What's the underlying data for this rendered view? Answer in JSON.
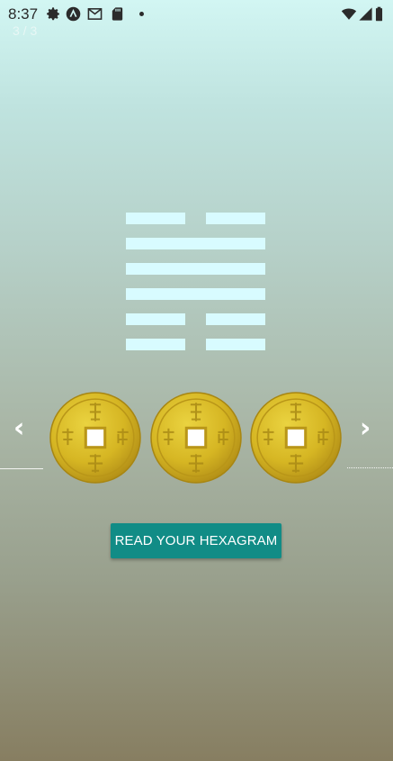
{
  "status_bar": {
    "time": "8:37",
    "left_icons": [
      "gear-icon",
      "a-circle-icon",
      "gmail-icon",
      "sd-card-icon",
      "dot-icon"
    ],
    "right_icons": [
      "wifi-icon",
      "signal-icon",
      "battery-icon"
    ]
  },
  "page_counter": "3 / 3",
  "hexagram": {
    "lines_top_to_bottom": [
      "broken",
      "solid",
      "solid",
      "solid",
      "broken",
      "broken"
    ],
    "line_color": "#d8fbff"
  },
  "navigation": {
    "prev_label": "‹",
    "next_label": "›"
  },
  "coins": {
    "count": 3,
    "icon": "chinese-coin-icon",
    "color": "#d2b31d"
  },
  "read_button": {
    "label": "READ YOUR HEXAGRAM",
    "color": "#118c86"
  }
}
